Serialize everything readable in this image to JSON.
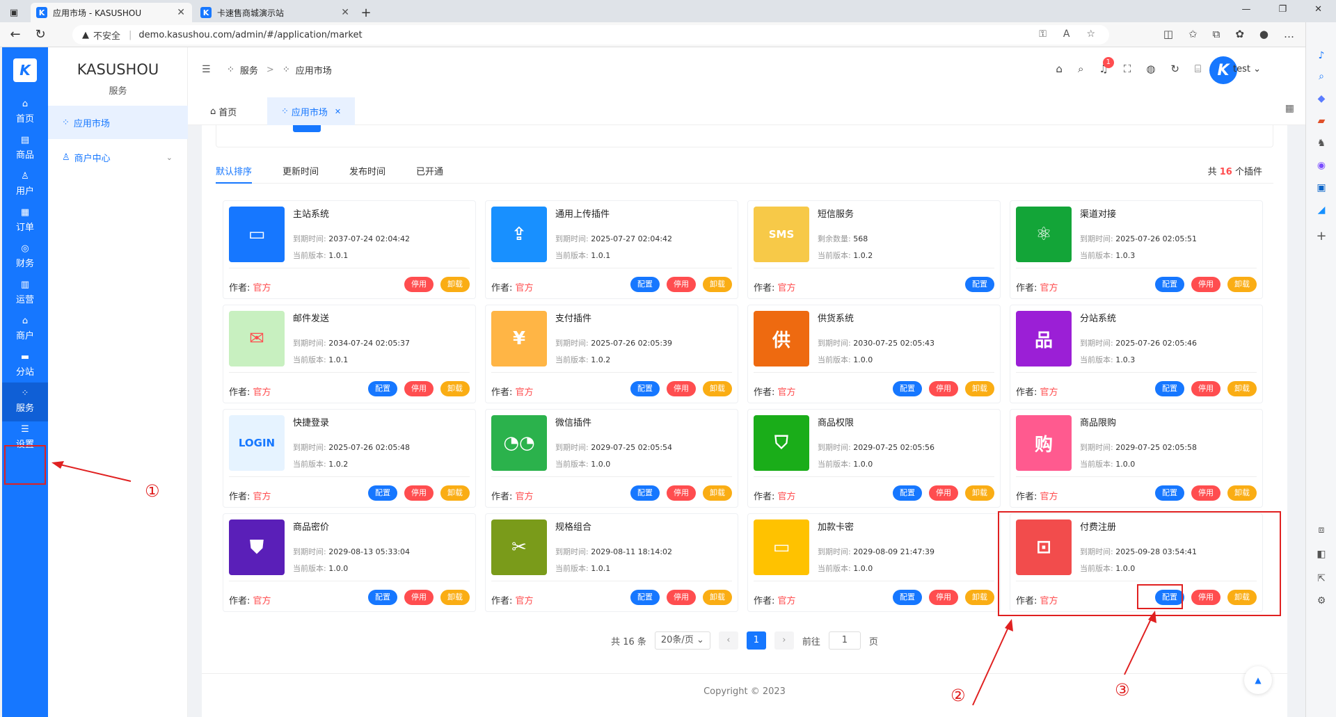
{
  "browser": {
    "tabs": [
      {
        "label": "应用市场 - KASUSHOU",
        "active": true
      },
      {
        "label": "卡速售商城演示站",
        "active": false
      }
    ],
    "insecure_label": "不安全",
    "url": "demo.kasushou.com/admin/#/application/market"
  },
  "leftnav": {
    "logo": "K",
    "items": [
      {
        "label": "首页",
        "icon": "home-icon"
      },
      {
        "label": "商品",
        "icon": "goods-icon"
      },
      {
        "label": "用户",
        "icon": "user-icon"
      },
      {
        "label": "订单",
        "icon": "order-icon"
      },
      {
        "label": "财务",
        "icon": "finance-icon"
      },
      {
        "label": "运营",
        "icon": "operate-icon"
      },
      {
        "label": "商户",
        "icon": "merchant-icon"
      },
      {
        "label": "分站",
        "icon": "substation-icon"
      },
      {
        "label": "服务",
        "icon": "service-icon",
        "active": true
      },
      {
        "label": "设置",
        "icon": "settings-icon"
      }
    ]
  },
  "submenu": {
    "brand": "KASUSHOU",
    "section": "服务",
    "items": [
      {
        "label": "应用市场",
        "active": true
      },
      {
        "label": "商户中心",
        "active": false
      }
    ]
  },
  "header": {
    "breadcrumb": [
      "服务",
      "应用市场"
    ],
    "notification_count": "1",
    "avatar_letter": "K",
    "user": "test"
  },
  "pagetabs": [
    {
      "label": "首页"
    },
    {
      "label": "应用市场",
      "active": true
    }
  ],
  "sort_tabs": [
    "默认排序",
    "更新时间",
    "发布时间",
    "已开通"
  ],
  "total": {
    "prefix": "共",
    "count": "16",
    "suffix": "个插件"
  },
  "labels": {
    "expire": "到期时间:",
    "version": "当前版本:",
    "remaining": "剩余数量:",
    "author": "作者:",
    "author_name": "官方",
    "config": "配置",
    "stop": "停用",
    "uninstall": "卸载"
  },
  "plugins": [
    {
      "name": "主站系统",
      "line1": "2037-07-24 02:04:42",
      "version": "1.0.1",
      "color": "#1677ff",
      "glyph": "▭",
      "buttons": [
        "stop",
        "uninstall"
      ]
    },
    {
      "name": "通用上传插件",
      "line1": "2025-07-27 02:04:42",
      "version": "1.0.1",
      "color": "#1890ff",
      "glyph": "⇪",
      "buttons": [
        "config",
        "stop",
        "uninstall"
      ]
    },
    {
      "name": "短信服务",
      "line1": "568",
      "line1_is_count": true,
      "version": "1.0.2",
      "color": "#f7c948",
      "glyph": "SMS",
      "buttons": [
        "config"
      ]
    },
    {
      "name": "渠道对接",
      "line1": "2025-07-26 02:05:51",
      "version": "1.0.3",
      "color": "#13a538",
      "glyph": "⚛",
      "buttons": [
        "config",
        "stop",
        "uninstall"
      ]
    },
    {
      "name": "邮件发送",
      "line1": "2034-07-24 02:05:37",
      "version": "1.0.1",
      "color": "#c8f0c0",
      "glyph": "✉",
      "buttons": [
        "config",
        "stop",
        "uninstall"
      ]
    },
    {
      "name": "支付插件",
      "line1": "2025-07-26 02:05:39",
      "version": "1.0.2",
      "color": "#ffb545",
      "glyph": "¥",
      "buttons": [
        "config",
        "stop",
        "uninstall"
      ]
    },
    {
      "name": "供货系统",
      "line1": "2030-07-25 02:05:43",
      "version": "1.0.0",
      "color": "#ee6a10",
      "glyph": "供",
      "buttons": [
        "config",
        "stop",
        "uninstall"
      ]
    },
    {
      "name": "分站系统",
      "line1": "2025-07-26 02:05:46",
      "version": "1.0.3",
      "color": "#9b1fd6",
      "glyph": "品",
      "buttons": [
        "config",
        "stop",
        "uninstall"
      ]
    },
    {
      "name": "快捷登录",
      "line1": "2025-07-26 02:05:48",
      "version": "1.0.2",
      "color": "#e6f3ff",
      "glyph": "LOGIN",
      "buttons": [
        "config",
        "stop",
        "uninstall"
      ]
    },
    {
      "name": "微信插件",
      "line1": "2029-07-25 02:05:54",
      "version": "1.0.0",
      "color": "#2bb24c",
      "glyph": "◔◔",
      "buttons": [
        "config",
        "stop",
        "uninstall"
      ]
    },
    {
      "name": "商品权限",
      "line1": "2029-07-25 02:05:56",
      "version": "1.0.0",
      "color": "#1aad19",
      "glyph": "⛉",
      "buttons": [
        "config",
        "stop",
        "uninstall"
      ]
    },
    {
      "name": "商品限购",
      "line1": "2029-07-25 02:05:58",
      "version": "1.0.0",
      "color": "#ff5a8f",
      "glyph": "购",
      "buttons": [
        "config",
        "stop",
        "uninstall"
      ]
    },
    {
      "name": "商品密价",
      "line1": "2029-08-13 05:33:04",
      "version": "1.0.0",
      "color": "#5a1fb8",
      "glyph": "⛊",
      "buttons": [
        "config",
        "stop",
        "uninstall"
      ]
    },
    {
      "name": "规格组合",
      "line1": "2029-08-11 18:14:02",
      "version": "1.0.1",
      "color": "#7a9b1a",
      "glyph": "✂",
      "buttons": [
        "config",
        "stop",
        "uninstall"
      ]
    },
    {
      "name": "加款卡密",
      "line1": "2029-08-09 21:47:39",
      "version": "1.0.0",
      "color": "#ffc200",
      "glyph": "▭",
      "buttons": [
        "config",
        "stop",
        "uninstall"
      ]
    },
    {
      "name": "付费注册",
      "line1": "2025-09-28 03:54:41",
      "version": "1.0.0",
      "color": "#f24c4c",
      "glyph": "⊡",
      "buttons": [
        "config",
        "stop",
        "uninstall"
      ]
    }
  ],
  "pagination": {
    "total": "共 16 条",
    "page_size": "20条/页",
    "current": "1",
    "goto_prefix": "前往",
    "goto_value": "1",
    "goto_suffix": "页"
  },
  "footer": "Copyright © 2023",
  "annotations": [
    "①",
    "②",
    "③"
  ]
}
